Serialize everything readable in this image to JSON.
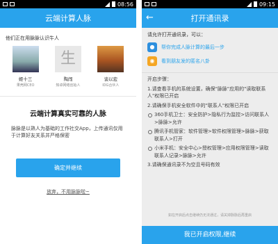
{
  "left": {
    "status_time": "08:56",
    "title": "云端计算人脉",
    "subtitle": "他们正在用脉脉认识牛人",
    "people": [
      {
        "name": "姬十三",
        "role": "果壳网CEO"
      },
      {
        "name": "陶闯",
        "role": "知卓网络创始人",
        "initial": "生"
      },
      {
        "name": "谈以宏",
        "role": "IDG合伙人"
      }
    ],
    "headline": "云端计算真实可靠的人脉",
    "description": "脉脉是以熟人为基础的工作社交App，上传通讯仅用于计算好友关系并严格保密",
    "confirm_button": "确定并继续",
    "giveup_link": "放弃，不用脉脉啦~"
  },
  "right": {
    "status_time": "09:15",
    "title": "打开通讯录",
    "intro": "请允许打开通讯录，可以：",
    "perms": [
      {
        "icon": "person-icon",
        "text": "帮你完成人脉计算的最后一步"
      },
      {
        "icon": "mask-icon",
        "text": "看到朋友发的匿名八卦"
      }
    ],
    "steps_title": "开启步骤：",
    "steps": [
      "1.请查看手机的系统设置，确保\"脉脉\"应用的\"读取联系人\"权限已开启",
      "2.请确保手机安全软件中的\"联系人\"权限已开启"
    ],
    "bullets": [
      "360手机卫士：安全防护>隐私行为监控>访问联系人>脉脉>允许",
      "腾讯手机管家：软件管理>软件权限管理>脉脉>获取联系人>打开",
      "小米手机：安全中心>授权管理>应用权限管理>读取联系人记录>脉脉>允许"
    ],
    "step3": "3.请确保通讯录不为空且号码有效",
    "footnote": "如在开启后点击继续仍无法通过，请关掉脉脉后再重启",
    "bottom_button": "我已开启权限,继续"
  },
  "colors": {
    "brand_blue": "#29a3ec",
    "accent_orange": "#f5a623"
  }
}
